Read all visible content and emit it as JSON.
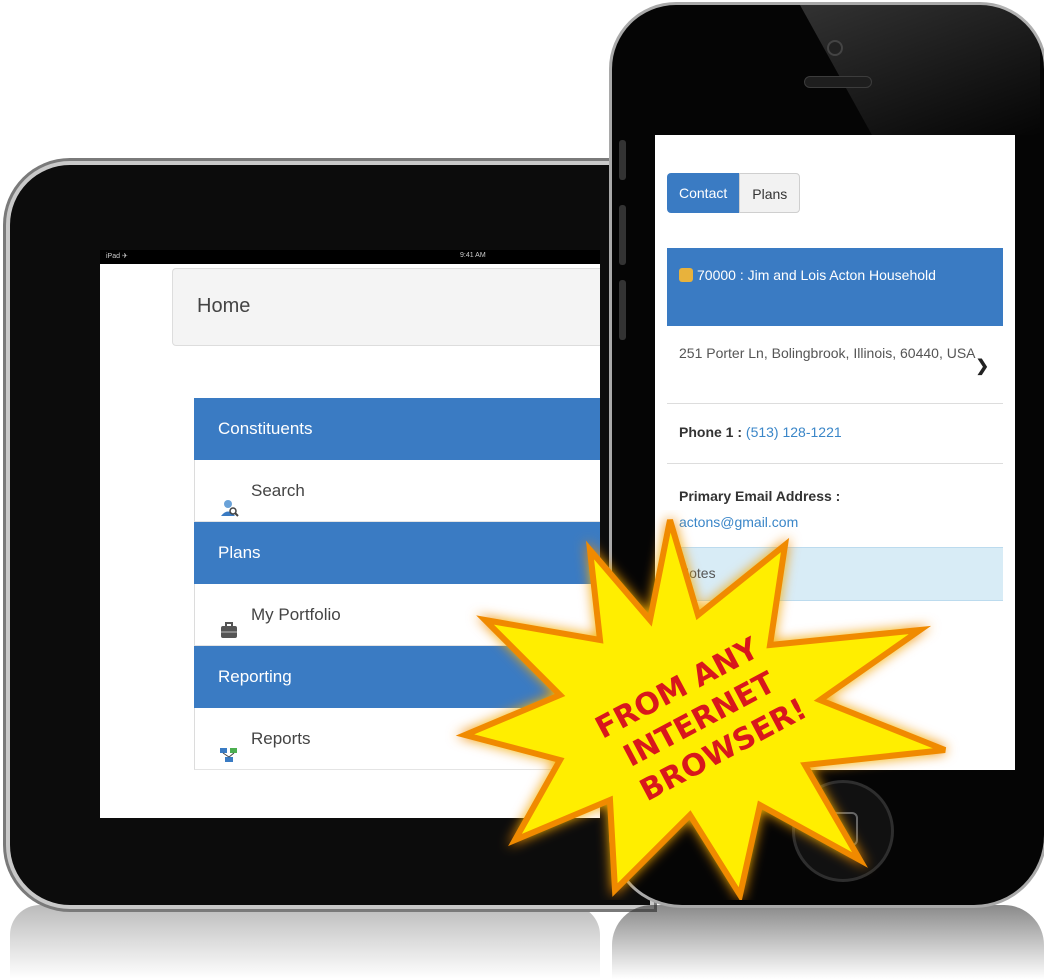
{
  "ipad": {
    "status": {
      "carrier": "iPad ✈",
      "time": "9:41 AM"
    },
    "page_title": "Home",
    "menu": [
      {
        "header": "Constituents",
        "item": "Search",
        "icon": "search-person-icon"
      },
      {
        "header": "Plans",
        "item": "My Portfolio",
        "icon": "portfolio-icon"
      },
      {
        "header": "Reporting",
        "item": "Reports",
        "icon": "reports-icon"
      }
    ]
  },
  "iphone": {
    "tabs": {
      "contact": "Contact",
      "plans": "Plans"
    },
    "household": "70000 : Jim and Lois Acton Household",
    "address": "251 Porter Ln, Bolingbrook, Illinois, 60440, USA",
    "phone": {
      "label": "Phone 1 :",
      "value": "(513) 128-1221"
    },
    "email": {
      "label": "Primary Email Address :",
      "value": "actons@gmail.com"
    },
    "notes_label": "Notes",
    "accent_color": "#3a7bc3"
  },
  "starburst": {
    "line1": "FROM ANY",
    "line2": "INTERNET",
    "line3": "BROWSER!",
    "fill_color": "#ffee00",
    "text_color": "#d8171c"
  }
}
